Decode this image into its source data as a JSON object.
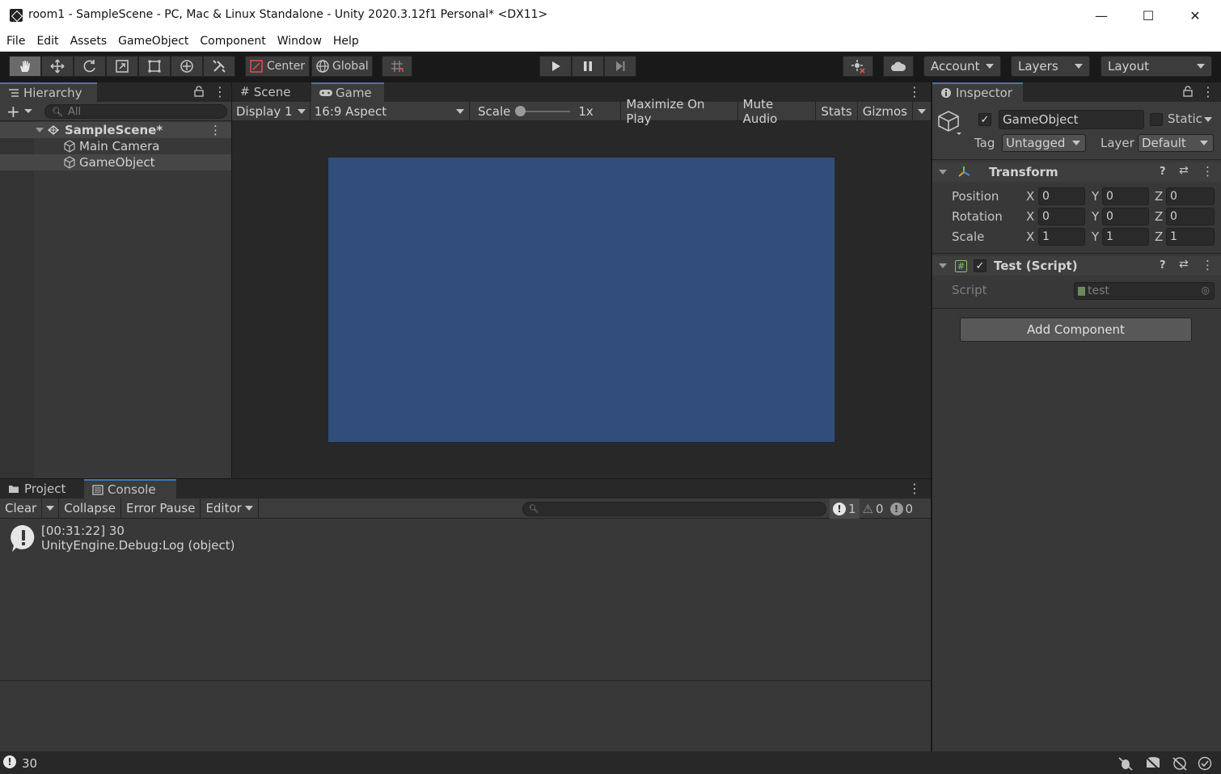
{
  "window": {
    "title": "room1 - SampleScene - PC, Mac & Linux Standalone - Unity 2020.3.12f1 Personal* <DX11>",
    "minimize": "—",
    "maximize": "☐",
    "close": "✕"
  },
  "menu": [
    "File",
    "Edit",
    "Assets",
    "GameObject",
    "Component",
    "Window",
    "Help"
  ],
  "toolbar": {
    "pivot": "Center",
    "space": "Global",
    "account": "Account",
    "layers": "Layers",
    "layout": "Layout"
  },
  "hierarchy": {
    "tab": "Hierarchy",
    "search_placeholder": "All",
    "scene": "SampleScene*",
    "items": [
      "Main Camera",
      "GameObject"
    ]
  },
  "game": {
    "tabs": [
      "Scene",
      "Game"
    ],
    "display": "Display 1",
    "aspect": "16:9 Aspect",
    "scale_label": "Scale",
    "scale_value": "1x",
    "maximize": "Maximize On Play",
    "mute": "Mute Audio",
    "stats": "Stats",
    "gizmos": "Gizmos",
    "canvas_color": "#314d79"
  },
  "inspector": {
    "tab": "Inspector",
    "object_name": "GameObject",
    "static_label": "Static",
    "tag_label": "Tag",
    "tag_value": "Untagged",
    "layer_label": "Layer",
    "layer_value": "Default",
    "transform": {
      "title": "Transform",
      "rows": [
        {
          "label": "Position",
          "x": "0",
          "y": "0",
          "z": "0"
        },
        {
          "label": "Rotation",
          "x": "0",
          "y": "0",
          "z": "0"
        },
        {
          "label": "Scale",
          "x": "1",
          "y": "1",
          "z": "1"
        }
      ],
      "axis": [
        "X",
        "Y",
        "Z"
      ]
    },
    "script_component": {
      "title": "Test (Script)",
      "script_label": "Script",
      "script_value": "test"
    },
    "add_component": "Add Component"
  },
  "console": {
    "tabs": [
      "Project",
      "Console"
    ],
    "clear": "Clear",
    "collapse": "Collapse",
    "error_pause": "Error Pause",
    "editor": "Editor",
    "counts": {
      "info": "1",
      "warnings": "0",
      "errors": "0"
    },
    "entry_line1": "[00:31:22] 30",
    "entry_line2": "UnityEngine.Debug:Log (object)"
  },
  "status": {
    "message": "30"
  }
}
